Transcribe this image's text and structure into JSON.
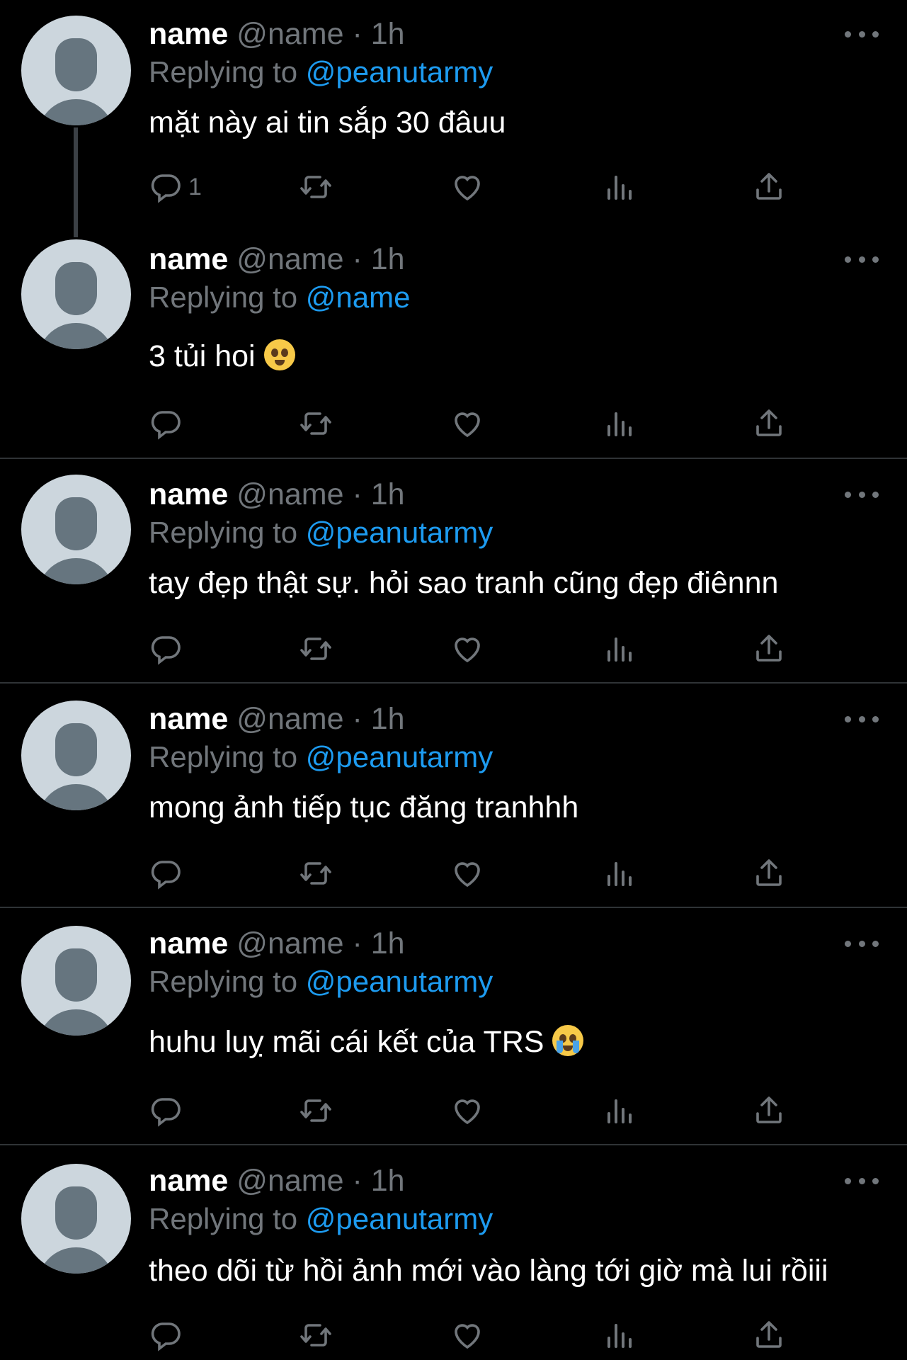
{
  "colors": {
    "background": "#000000",
    "text": "#ffffff",
    "muted": "#71767b",
    "mention": "#1d9bf0",
    "avatar_bg": "#ccd6dd"
  },
  "icons": [
    "reply-icon",
    "retweet-icon",
    "like-icon",
    "views-icon",
    "share-icon",
    "more-icon"
  ],
  "tweets": [
    {
      "name": "name",
      "handle": "@name",
      "time": "· 1h",
      "replying_label": "Replying to",
      "replying_to": "@peanutarmy",
      "text": "mặt này ai tin sắp 30 đâuu",
      "reply_count": "1"
    },
    {
      "name": "name",
      "handle": "@name",
      "time": "· 1h",
      "replying_label": "Replying to",
      "replying_to": "@name",
      "text": "3 tủi hoi",
      "emoji": "pleading-face",
      "reply_count": ""
    },
    {
      "name": "name",
      "handle": "@name",
      "time": "· 1h",
      "replying_label": "Replying to",
      "replying_to": "@peanutarmy",
      "text": "tay đẹp thật sự. hỏi sao tranh cũng đẹp điênnn",
      "reply_count": ""
    },
    {
      "name": "name",
      "handle": "@name",
      "time": "· 1h",
      "replying_label": "Replying to",
      "replying_to": "@peanutarmy",
      "text": "mong ảnh tiếp tục đăng tranhhh",
      "reply_count": ""
    },
    {
      "name": "name",
      "handle": "@name",
      "time": "· 1h",
      "replying_label": "Replying to",
      "replying_to": "@peanutarmy",
      "text": "huhu luỵ mãi cái kết của TRS",
      "emoji": "loudly-crying-face",
      "reply_count": ""
    },
    {
      "name": "name",
      "handle": "@name",
      "time": "· 1h",
      "replying_label": "Replying to",
      "replying_to": "@peanutarmy",
      "text": "theo dõi từ hồi ảnh mới vào làng tới giờ mà lui rồiii",
      "reply_count": ""
    }
  ]
}
